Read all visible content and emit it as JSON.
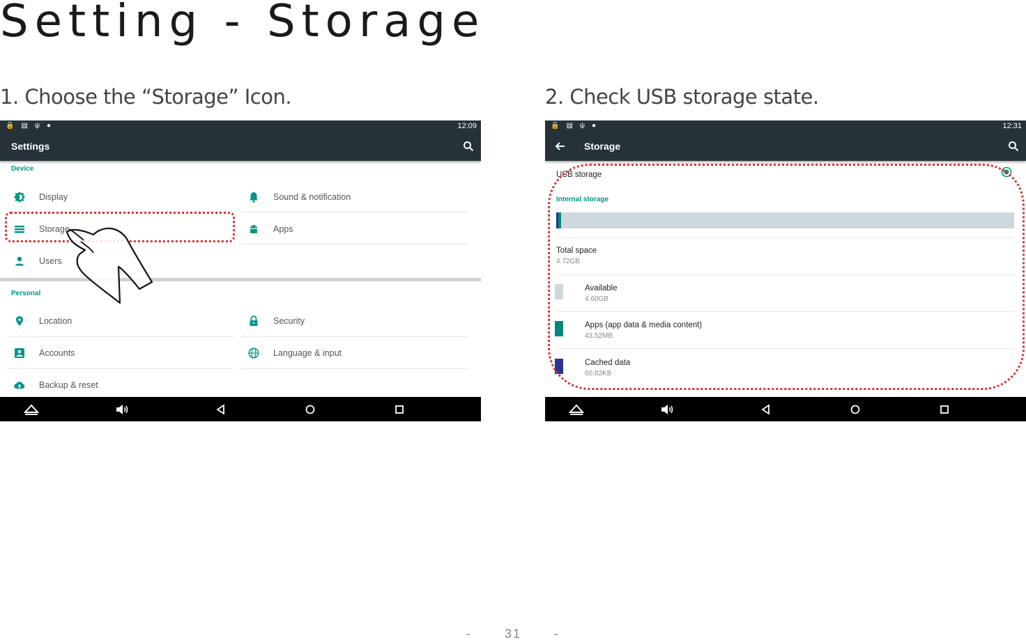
{
  "page": {
    "title": "Setting - Storage",
    "page_number": "31",
    "page_dash": "-"
  },
  "steps": [
    {
      "caption": "1. Choose the “Storage” Icon."
    },
    {
      "caption": "2. Check USB storage state."
    }
  ],
  "screen1": {
    "time": "12:09",
    "app_title": "Settings",
    "sections": [
      {
        "header": "Device"
      },
      {
        "header": "Personal"
      }
    ],
    "device_items": [
      {
        "label": "Display",
        "icon": "brightness-icon"
      },
      {
        "label": "Sound & notification",
        "icon": "bell-icon"
      },
      {
        "label": "Storage",
        "icon": "storage-list-icon"
      },
      {
        "label": "Apps",
        "icon": "android-icon"
      },
      {
        "label": "Users",
        "icon": "person-icon"
      }
    ],
    "personal_items": [
      {
        "label": "Location",
        "icon": "location-pin-icon"
      },
      {
        "label": "Security",
        "icon": "lock-icon"
      },
      {
        "label": "Accounts",
        "icon": "account-box-icon"
      },
      {
        "label": "Language & input",
        "icon": "globe-icon"
      },
      {
        "label": "Backup & reset",
        "icon": "cloud-upload-icon"
      }
    ]
  },
  "screen2": {
    "time": "12:31",
    "app_title": "Storage",
    "usb_storage_label": "USB storage",
    "internal_storage_header": "Internal storage",
    "used_fraction": 0.01,
    "rows": [
      {
        "title": "Total space",
        "value": "4.72GB"
      },
      {
        "title": "Available",
        "value": "4.60GB",
        "color": "#cfd8dc"
      },
      {
        "title": "Apps (app data & media content)",
        "value": "43.52MB",
        "color": "#00897b"
      },
      {
        "title": "Cached data",
        "value": "60.82KB",
        "color": "#283593"
      }
    ],
    "bar_colors": {
      "track": "#cfd8dc",
      "used_a": "#283593",
      "used_b": "#00897b"
    }
  },
  "colors": {
    "toolbar": "#263238",
    "accent": "#009688",
    "highlight": "#e0312f"
  }
}
